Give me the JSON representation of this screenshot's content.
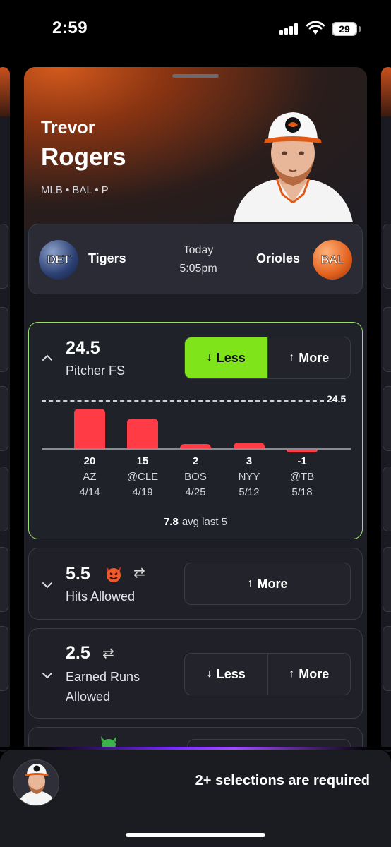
{
  "status": {
    "time": "2:59",
    "battery": "29"
  },
  "player": {
    "first_name": "Trevor",
    "last_name": "Rogers",
    "meta": "MLB • BAL  • P"
  },
  "matchup": {
    "home_abbr": "DET",
    "home_team": "Tigers",
    "away_abbr": "BAL",
    "away_team": "Orioles",
    "day": "Today",
    "time": "5:05pm"
  },
  "props": [
    {
      "line": "24.5",
      "stat": "Pitcher FS",
      "less_label": "Less",
      "more_label": "More",
      "selected": "less"
    },
    {
      "line": "5.5",
      "stat": "Hits Allowed",
      "more_label": "More",
      "icons": [
        "devil-icon",
        "swap-icon"
      ]
    },
    {
      "line": "2.5",
      "stat_line1": "Earned Runs",
      "stat_line2": "Allowed",
      "less_label": "Less",
      "more_label": "More",
      "icons": [
        "swap-icon"
      ]
    }
  ],
  "chart_data": {
    "type": "bar",
    "threshold": 24.5,
    "threshold_label": "24.5",
    "categories": [
      "AZ",
      "@CLE",
      "BOS",
      "NYY",
      "@TB"
    ],
    "dates": [
      "4/14",
      "4/19",
      "4/25",
      "5/12",
      "5/18"
    ],
    "values": [
      20,
      15,
      2,
      3,
      -1
    ],
    "value_labels": [
      "20",
      "15",
      "2",
      "3",
      "-1"
    ],
    "avg_value": "7.8",
    "avg_label": "avg last 5",
    "colors": {
      "bar": "#ff3b45"
    }
  },
  "footer": {
    "message": "2+ selections are required"
  },
  "colors": {
    "accent": "#7fe51a",
    "active_border": "#9be06b",
    "brand_orange": "#e3611e"
  }
}
